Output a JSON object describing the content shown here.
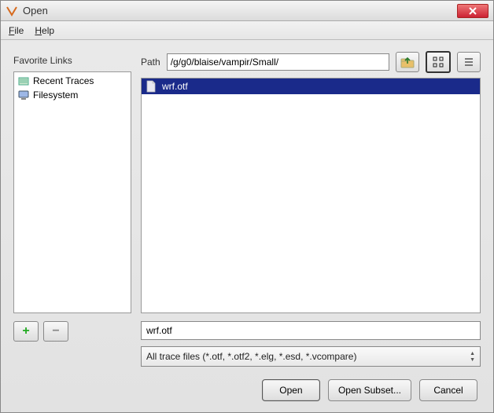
{
  "window": {
    "title": "Open"
  },
  "menu": {
    "file": "File",
    "help": "Help"
  },
  "favorites": {
    "label": "Favorite Links",
    "items": [
      {
        "label": "Recent Traces"
      },
      {
        "label": "Filesystem"
      }
    ]
  },
  "path": {
    "label": "Path",
    "value": "/g/g0/blaise/vampir/Small/"
  },
  "toolbar": {
    "up_icon": "parent-folder-icon",
    "icon_view_icon": "icon-view-icon",
    "list_view_icon": "list-view-icon"
  },
  "files": [
    {
      "name": "wrf.otf",
      "selected": true
    }
  ],
  "filename": {
    "value": "wrf.otf"
  },
  "filter": {
    "value": "All trace files (*.otf, *.otf2, *.elg, *.esd, *.vcompare)"
  },
  "buttons": {
    "open": "Open",
    "open_subset": "Open Subset...",
    "cancel": "Cancel",
    "add": "+",
    "remove": "−"
  }
}
